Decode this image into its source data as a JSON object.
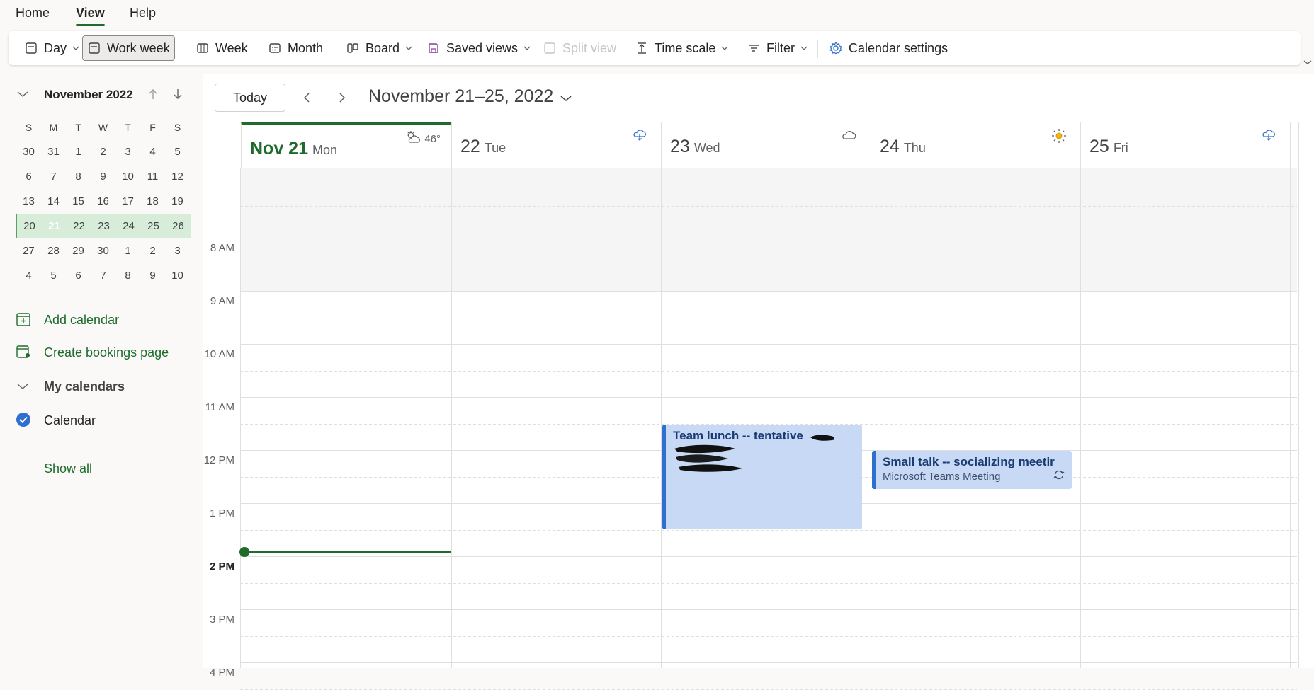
{
  "menu": {
    "tabs": [
      "Home",
      "View",
      "Help"
    ],
    "active": "View"
  },
  "ribbon": {
    "day": "Day",
    "work_week": "Work week",
    "week": "Week",
    "month": "Month",
    "board": "Board",
    "saved_views": "Saved views",
    "split_view": "Split view",
    "time_scale": "Time scale",
    "filter": "Filter",
    "calendar_settings": "Calendar settings"
  },
  "mini_calendar": {
    "month_label": "November 2022",
    "weekdays": [
      "S",
      "M",
      "T",
      "W",
      "T",
      "F",
      "S"
    ],
    "weeks": [
      [
        "30",
        "31",
        "1",
        "2",
        "3",
        "4",
        "5"
      ],
      [
        "6",
        "7",
        "8",
        "9",
        "10",
        "11",
        "12"
      ],
      [
        "13",
        "14",
        "15",
        "16",
        "17",
        "18",
        "19"
      ],
      [
        "20",
        "21",
        "22",
        "23",
        "24",
        "25",
        "26"
      ],
      [
        "27",
        "28",
        "29",
        "30",
        "1",
        "2",
        "3"
      ],
      [
        "4",
        "5",
        "6",
        "7",
        "8",
        "9",
        "10"
      ]
    ],
    "today": "21"
  },
  "sidebar": {
    "add_calendar": "Add calendar",
    "create_bookings": "Create bookings page",
    "my_calendars": "My calendars",
    "calendar_name": "Calendar",
    "show_all": "Show all"
  },
  "toolbar": {
    "today": "Today",
    "range": "November 21–25, 2022"
  },
  "days": [
    {
      "num": "Nov 21",
      "name": "Mon",
      "weather": "46°",
      "weather_icon": "partly-sunny-icon",
      "current": true
    },
    {
      "num": "22",
      "name": "Tue",
      "weather": "",
      "weather_icon": "rain-cloud-icon",
      "current": false
    },
    {
      "num": "23",
      "name": "Wed",
      "weather": "",
      "weather_icon": "cloud-icon",
      "current": false
    },
    {
      "num": "24",
      "name": "Thu",
      "weather": "",
      "weather_icon": "sun-icon",
      "current": false
    },
    {
      "num": "25",
      "name": "Fri",
      "weather": "",
      "weather_icon": "rain-cloud-icon",
      "current": false
    }
  ],
  "times": [
    "8 AM",
    "9 AM",
    "10 AM",
    "11 AM",
    "12 PM",
    "1 PM",
    "2 PM",
    "3 PM",
    "4 PM"
  ],
  "events": [
    {
      "title": "Team lunch -- tentative",
      "sub": ""
    },
    {
      "title": "Small talk -- socializing meetir",
      "sub": "Microsoft Teams Meeting"
    }
  ],
  "colors": {
    "accent": "#1e6b2c",
    "event_bg": "#c7d9f4",
    "event_bar": "#2f6fcf"
  }
}
